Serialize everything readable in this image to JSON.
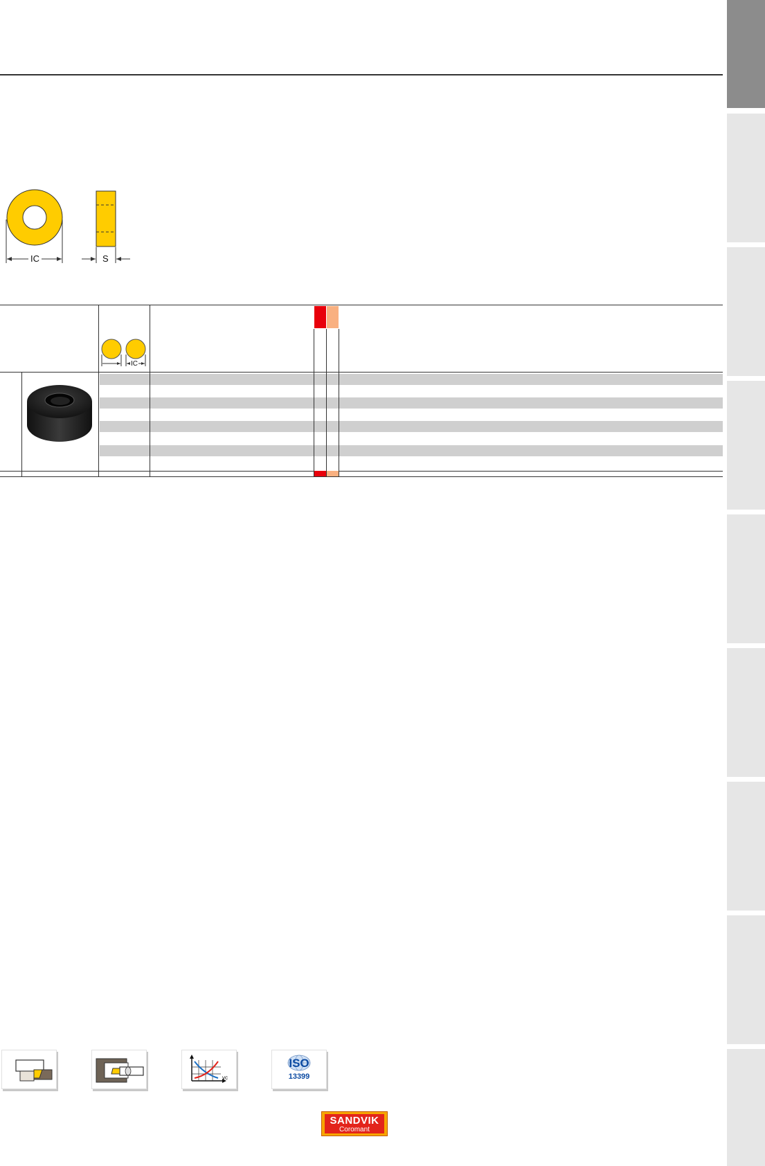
{
  "schematic": {
    "ic_label": "IC",
    "s_label": "S",
    "insert_color": "#ffcc00"
  },
  "table": {
    "header_ic_label": "IC",
    "grade_colors": [
      "#e8000b",
      "#f9b080"
    ],
    "shaded_row_color": "#cfcfcf"
  },
  "footer": {
    "icons": [
      "external-turning-icon",
      "internal-turning-icon",
      "cutting-data-chart-icon",
      "iso-13399-icon"
    ],
    "iso_text": "ISO",
    "iso_number": "13399",
    "chart_axis_label": "vc"
  },
  "brand": {
    "name": "SANDVIK",
    "sub": "Coromant"
  }
}
